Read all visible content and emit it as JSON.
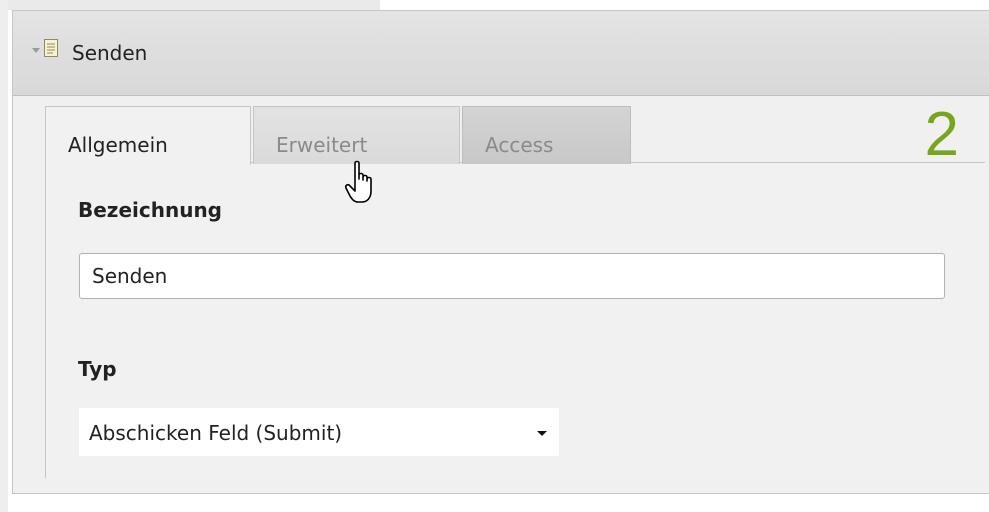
{
  "panel": {
    "title": "Senden"
  },
  "tabs": [
    {
      "label": "Allgemein",
      "active": true
    },
    {
      "label": "Erweitert",
      "active": false
    },
    {
      "label": "Access",
      "active": false
    }
  ],
  "step_marker": "2",
  "form": {
    "name_label": "Bezeichnung",
    "name_value": "Senden",
    "type_label": "Typ",
    "type_selected": "Abschicken Feld (Submit)"
  },
  "colors": {
    "step_marker": "#77a51c",
    "header_bg": "#dedede",
    "content_bg": "#f1f1f1"
  },
  "icons": {
    "collapse": "chevron-down-icon",
    "element": "document-icon",
    "cursor": "hand-pointer-icon",
    "select_caret": "caret-down-icon"
  }
}
